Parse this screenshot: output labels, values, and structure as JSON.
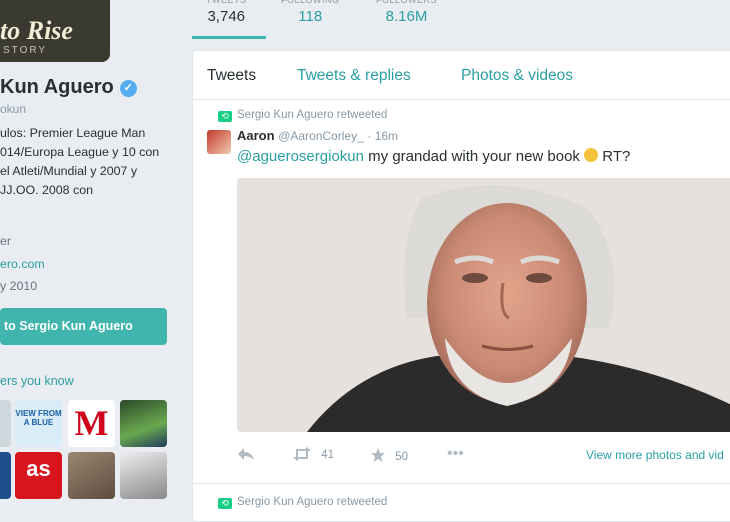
{
  "profile": {
    "banner_logo": "to Rise",
    "banner_sub": "STORY",
    "name": "Kun Aguero",
    "handle": "okun",
    "bio": "ulos: Premier League Man 014/Europa League y 10 con el Atleti/Mundial y 2007 y JJ.OO. 2008 con",
    "location": "er",
    "website": "ero.com",
    "joined": "y 2010",
    "tweet_to_button": "to Sergio Kun Aguero",
    "followers_you_know": "ers you know"
  },
  "stats": {
    "tweets_label": "TWEETS",
    "tweets_value": "3,746",
    "following_label": "FOLLOWING",
    "following_value": "118",
    "followers_label": "FOLLOWERS",
    "followers_value": "8.16M"
  },
  "tabs": [
    "Tweets",
    "Tweets & replies",
    "Photos & videos"
  ],
  "tweet": {
    "retweeted_by": "Sergio Kun Aguero retweeted",
    "author_name": "Aaron",
    "author_handle": "@AaronCorley_",
    "time": "· 16m",
    "mention": "@aguerosergiokun",
    "text": " my grandad with your new book ",
    "text_end": " RT?",
    "retweets": "41",
    "favorites": "50",
    "view_more": "View more photos and vid"
  },
  "next_tweet": {
    "retweeted_by": "Sergio Kun Aguero retweeted"
  },
  "colors": {
    "accent": "#3fb5ad",
    "link": "#2a9fa3",
    "retweet_green": "#19cf86",
    "muted": "#8899a6"
  },
  "tiles": [
    {
      "name": "followed-avatar-1",
      "text": ""
    },
    {
      "name": "followed-avatar-view-from-a-blue",
      "text": "VIEW FROM A BLUE"
    },
    {
      "name": "followed-avatar-marca",
      "text": "M"
    },
    {
      "name": "followed-avatar-4",
      "text": ""
    },
    {
      "name": "followed-avatar-5",
      "text": ""
    },
    {
      "name": "followed-avatar-as",
      "text": "as"
    },
    {
      "name": "followed-avatar-7",
      "text": ""
    },
    {
      "name": "followed-avatar-8",
      "text": ""
    }
  ]
}
